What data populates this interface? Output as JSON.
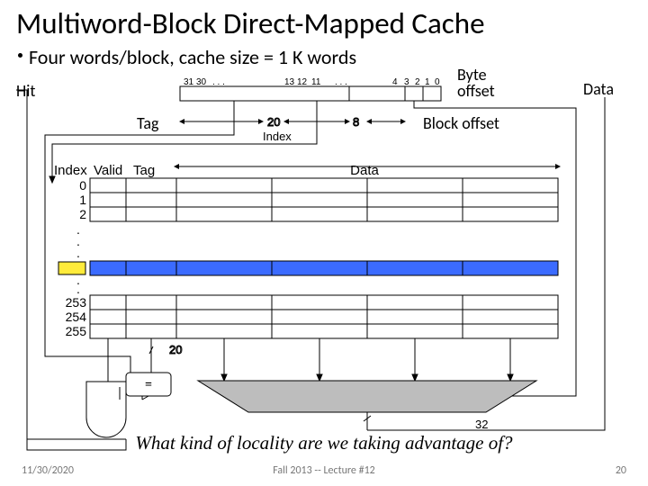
{
  "title": "Multiword-Block Direct-Mapped Cache",
  "bullet": "Four  words/block, cache size = 1 K words",
  "labels": {
    "hit": "Hit",
    "byte1": "Byte",
    "byte2": "offset",
    "data": "Data",
    "tag": "Tag",
    "blockoffset": "Block offset",
    "index": "Index",
    "valid": "Valid",
    "indexcol": "Index",
    "tagcol": "Tag",
    "datacol": "Data",
    "eq": "="
  },
  "bits": {
    "b31": "31",
    "b30": "30",
    "dots1": ". . .",
    "b13": "13",
    "b12": "12",
    "b11": "11",
    "dots2": ". . .",
    "b4": "4",
    "b3": "3",
    "b2": "2",
    "b1": "1",
    "b0": "0"
  },
  "widths": {
    "tag": "20",
    "index": "8",
    "compare": "20",
    "out": "32"
  },
  "rows": {
    "r0": "0",
    "r1": "1",
    "r2": "2",
    "r253": "253",
    "r254": "254",
    "r255": "255",
    "dots": "."
  },
  "question": "What kind of locality are we taking advantage of?",
  "footer": {
    "left": "11/30/2020",
    "center": "Fall 2013 -- Lecture #12",
    "right": "20"
  }
}
